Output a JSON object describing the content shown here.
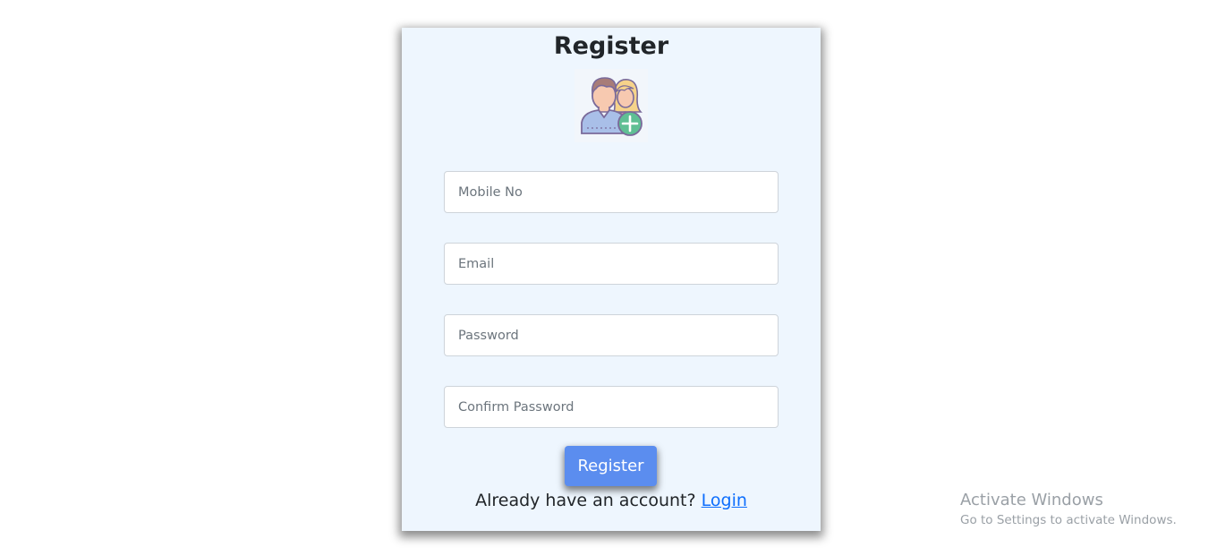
{
  "form": {
    "title": "Register",
    "fields": [
      {
        "placeholder": "Mobile No",
        "value": ""
      },
      {
        "placeholder": "Email",
        "value": ""
      },
      {
        "placeholder": "Password",
        "value": ""
      },
      {
        "placeholder": "Confirm Password",
        "value": ""
      }
    ],
    "submit_label": "Register",
    "footer_text": "Already have an account?",
    "login_link": "Login",
    "avatar_icon": "add-users-icon"
  },
  "watermark": {
    "title": "Activate Windows",
    "subtitle": "Go to Settings to activate Windows."
  },
  "colors": {
    "card_background": "#eef6fe",
    "button": "#5b8def",
    "link": "#0d6efd"
  }
}
